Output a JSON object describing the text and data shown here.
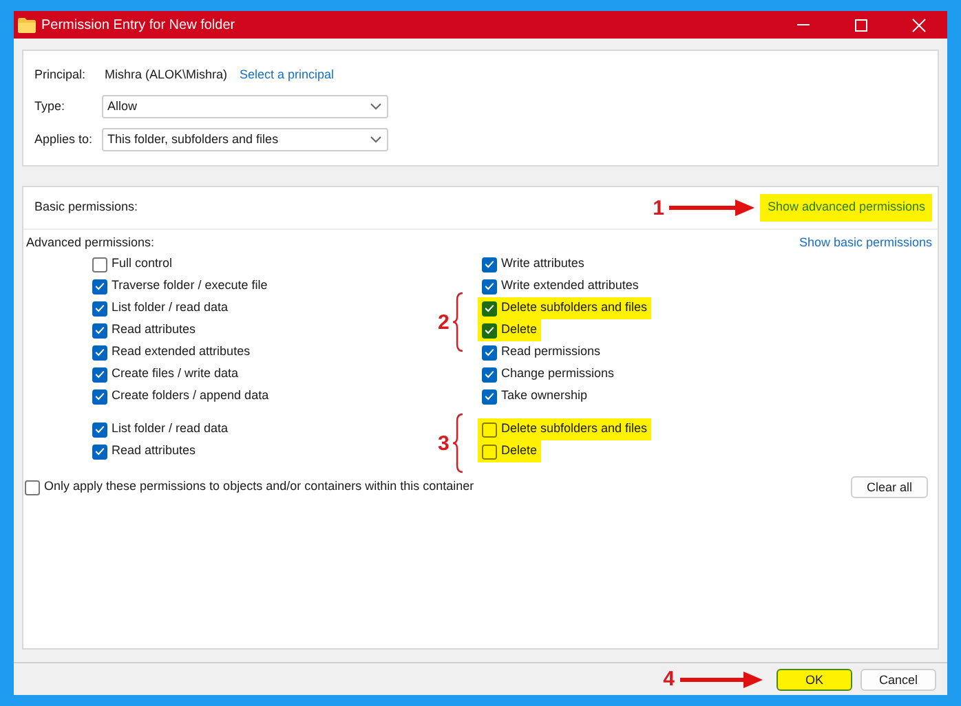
{
  "window": {
    "title": "Permission Entry for New folder"
  },
  "principal": {
    "label": "Principal:",
    "value": "Mishra (ALOK\\Mishra)",
    "link": "Select a principal"
  },
  "type": {
    "label": "Type:",
    "value": "Allow"
  },
  "applies_to": {
    "label": "Applies to:",
    "value": "This folder, subfolders and files"
  },
  "basic_permissions": {
    "label": "Basic permissions:",
    "link": "Show advanced permissions",
    "highlighted": true,
    "callout": {
      "number": "1",
      "kind": "arrow"
    }
  },
  "advanced_permissions": {
    "label": "Advanced permissions:",
    "link": "Show basic permissions"
  },
  "permission_groups": [
    {
      "callout": {
        "number": "2",
        "kind": "brace"
      },
      "left": [
        {
          "label": "Full control",
          "checked": false,
          "highlighted": false
        },
        {
          "label": "Traverse folder / execute file",
          "checked": true,
          "highlighted": false
        },
        {
          "label": "List folder / read data",
          "checked": true,
          "highlighted": false
        },
        {
          "label": "Read attributes",
          "checked": true,
          "highlighted": false
        },
        {
          "label": "Read extended attributes",
          "checked": true,
          "highlighted": false
        },
        {
          "label": "Create files / write data",
          "checked": true,
          "highlighted": false
        },
        {
          "label": "Create folders / append data",
          "checked": true,
          "highlighted": false
        }
      ],
      "right": [
        {
          "label": "Write attributes",
          "checked": true,
          "highlighted": false
        },
        {
          "label": "Write extended attributes",
          "checked": true,
          "highlighted": false
        },
        {
          "label": "Delete subfolders and files",
          "checked": true,
          "highlighted": true
        },
        {
          "label": "Delete",
          "checked": true,
          "highlighted": true
        },
        {
          "label": "Read permissions",
          "checked": true,
          "highlighted": false
        },
        {
          "label": "Change permissions",
          "checked": true,
          "highlighted": false
        },
        {
          "label": "Take ownership",
          "checked": true,
          "highlighted": false
        }
      ]
    },
    {
      "callout": {
        "number": "3",
        "kind": "brace"
      },
      "left": [
        {
          "label": "List folder / read data",
          "checked": true,
          "highlighted": false
        },
        {
          "label": "Read attributes",
          "checked": true,
          "highlighted": false
        }
      ],
      "right": [
        {
          "label": "Delete subfolders and files",
          "checked": false,
          "highlighted": true
        },
        {
          "label": "Delete",
          "checked": false,
          "highlighted": true
        }
      ]
    }
  ],
  "only_apply": {
    "label": "Only apply these permissions to objects and/or containers within this container",
    "checked": false
  },
  "clear_all": "Clear all",
  "buttons": [
    {
      "label": "OK",
      "highlighted": true,
      "callout": {
        "number": "4",
        "kind": "arrow"
      }
    },
    {
      "label": "Cancel",
      "highlighted": false
    }
  ]
}
